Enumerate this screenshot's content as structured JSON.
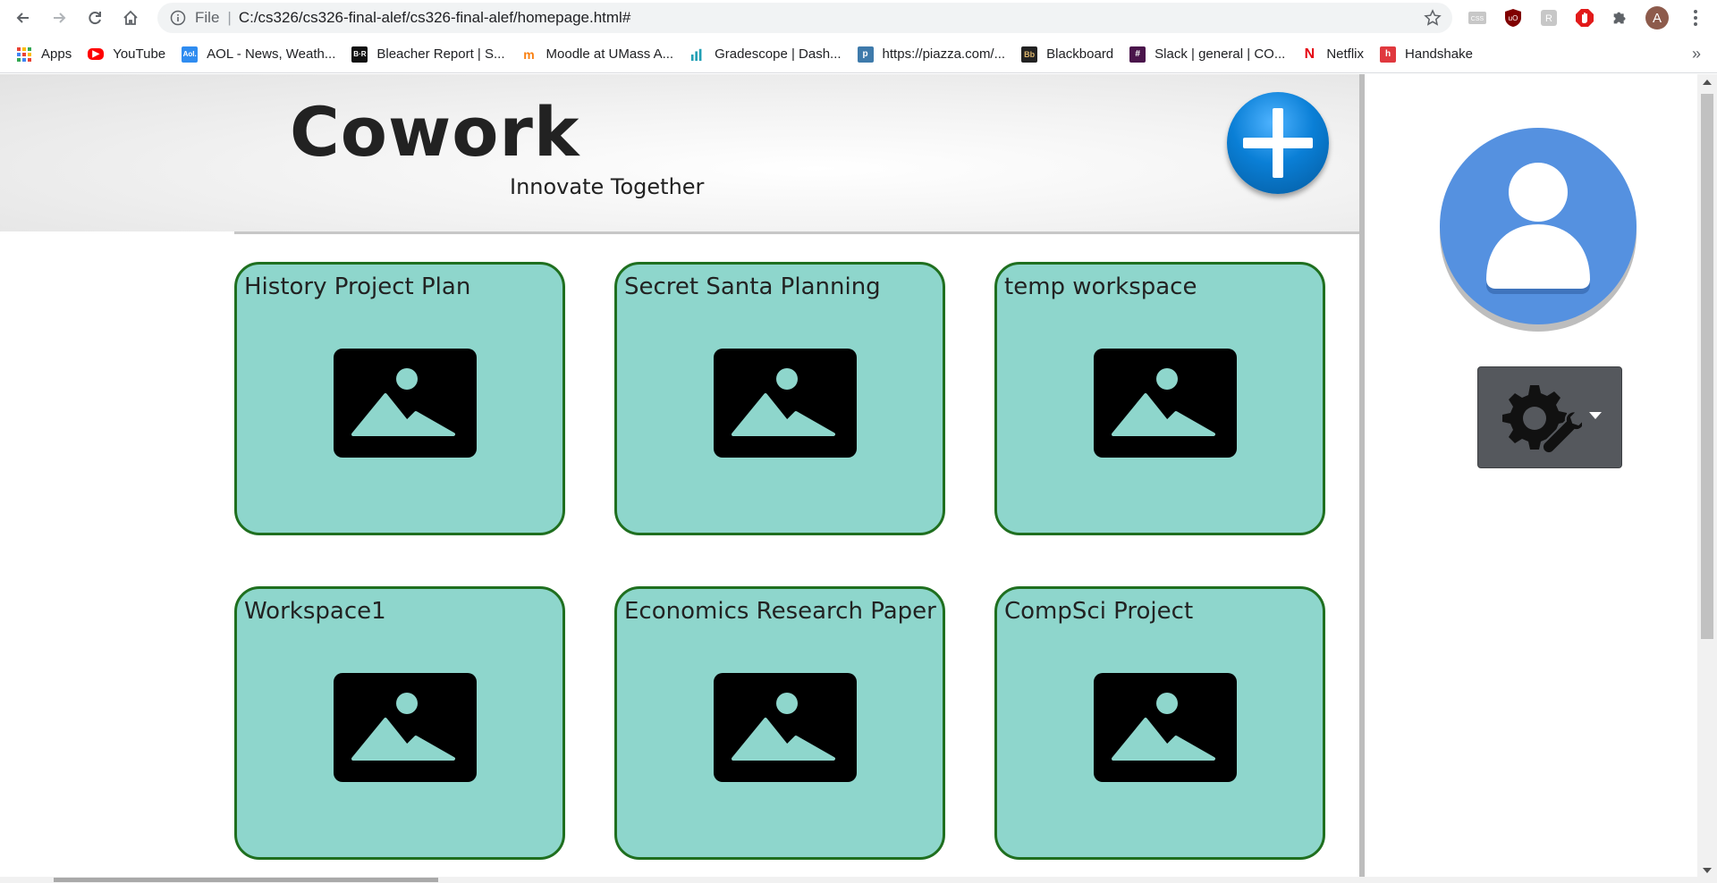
{
  "browser": {
    "url_protocol": "File",
    "url": "C:/cs326/cs326-final-alef/cs326-final-alef/homepage.html#",
    "profile_initial": "A",
    "bookmarks": [
      {
        "label": "Apps",
        "icon": "apps-grid-icon"
      },
      {
        "label": "YouTube",
        "icon": "youtube-icon",
        "color": "#ff0000"
      },
      {
        "label": "AOL - News, Weath...",
        "icon": "aol-icon",
        "color": "#2f8cf0"
      },
      {
        "label": "Bleacher Report | S...",
        "icon": "bleacher-report-icon",
        "color": "#111111"
      },
      {
        "label": "Moodle at UMass A...",
        "icon": "moodle-icon",
        "color": "#f98012"
      },
      {
        "label": "Gradescope | Dash...",
        "icon": "gradescope-icon",
        "color": "#23a0b5"
      },
      {
        "label": "https://piazza.com/...",
        "icon": "piazza-icon",
        "color": "#3e7aab"
      },
      {
        "label": "Blackboard",
        "icon": "blackboard-icon",
        "color": "#222222"
      },
      {
        "label": "Slack | general | CO...",
        "icon": "slack-icon",
        "color": "#4a154b"
      },
      {
        "label": "Netflix",
        "icon": "netflix-icon",
        "color": "#e50914"
      },
      {
        "label": "Handshake",
        "icon": "handshake-icon",
        "color": "#e0383e"
      }
    ]
  },
  "header": {
    "brand": "Cowork",
    "tagline": "Innovate Together"
  },
  "workspaces": [
    {
      "title": "History Project Plan"
    },
    {
      "title": "Secret Santa Planning"
    },
    {
      "title": "temp workspace"
    },
    {
      "title": "Workspace1"
    },
    {
      "title": "Economics Research Paper"
    },
    {
      "title": "CompSci Project"
    }
  ],
  "colors": {
    "card_bg": "#8ed6cc",
    "card_border": "#1f6f1f",
    "add_button": "#0a7fd6",
    "avatar": "#5591e0",
    "settings_button": "#55585d"
  }
}
